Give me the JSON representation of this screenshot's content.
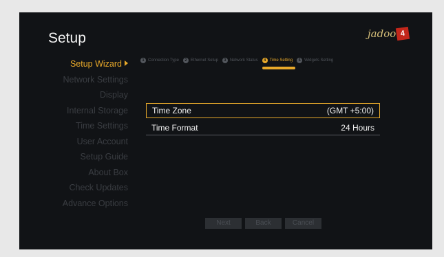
{
  "header": {
    "title": "Setup",
    "logo_text": "jadoo",
    "logo_badge": "4"
  },
  "sidebar": {
    "items": [
      {
        "label": "Setup Wizard",
        "active": true
      },
      {
        "label": "Network Settings"
      },
      {
        "label": "Display"
      },
      {
        "label": "Internal Storage"
      },
      {
        "label": "Time Settings"
      },
      {
        "label": "User Account"
      },
      {
        "label": "Setup Guide"
      },
      {
        "label": "About Box"
      },
      {
        "label": "Check Updates"
      },
      {
        "label": "Advance Options"
      }
    ]
  },
  "wizard_steps": [
    {
      "num": "1",
      "label": "Connection Type"
    },
    {
      "num": "2",
      "label": "Ethernet Setup"
    },
    {
      "num": "3",
      "label": "Network Status"
    },
    {
      "num": "4",
      "label": "Time Setting",
      "active": true
    },
    {
      "num": "5",
      "label": "Widgets Setting"
    }
  ],
  "settings": [
    {
      "label": "Time Zone",
      "value": "(GMT +5:00)",
      "selected": true
    },
    {
      "label": "Time Format",
      "value": "24 Hours"
    }
  ],
  "buttons": {
    "next": "Next",
    "back": "Back",
    "cancel": "Cancel"
  },
  "colors": {
    "accent": "#e8a92a",
    "background": "#111316",
    "inactive_text": "#3a3d42"
  }
}
